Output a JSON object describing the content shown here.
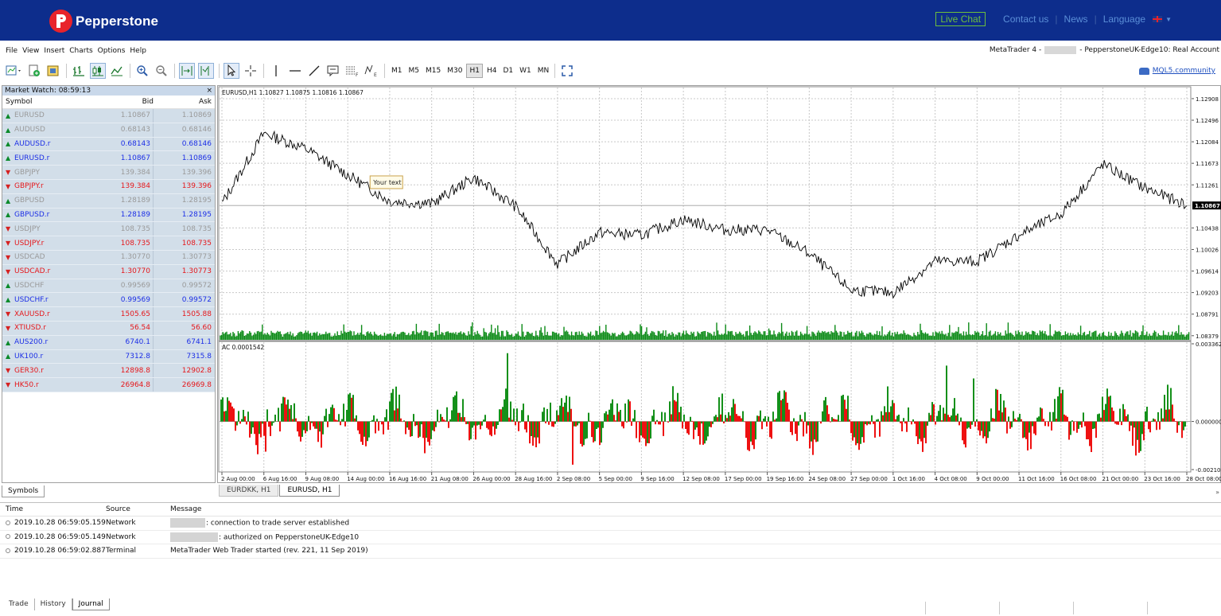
{
  "brand": {
    "name": "Pepperstone"
  },
  "topnav": {
    "live_chat": "Live Chat",
    "contact": "Contact us",
    "news": "News",
    "language": "Language"
  },
  "menu": [
    "File",
    "View",
    "Insert",
    "Charts",
    "Options",
    "Help"
  ],
  "window": {
    "title_prefix": "MetaTrader 4 -",
    "title_suffix": "- PepperstoneUK-Edge10: Real Account"
  },
  "toolbar": {
    "timeframes": [
      "M1",
      "M5",
      "M15",
      "M30",
      "H1",
      "H4",
      "D1",
      "W1",
      "MN"
    ],
    "selected_timeframe": "H1",
    "community_link": "MQL5.community"
  },
  "market_watch": {
    "title": "Market Watch: 08:59:13",
    "close": "×",
    "headers": {
      "symbol": "Symbol",
      "bid": "Bid",
      "ask": "Ask"
    },
    "rows": [
      {
        "symbol": "EURUSD",
        "bid": "1.10867",
        "ask": "1.10869",
        "dir": "up",
        "style": "grey"
      },
      {
        "symbol": "AUDUSD",
        "bid": "0.68143",
        "ask": "0.68146",
        "dir": "up",
        "style": "grey"
      },
      {
        "symbol": "AUDUSD.r",
        "bid": "0.68143",
        "ask": "0.68146",
        "dir": "up",
        "style": "blue"
      },
      {
        "symbol": "EURUSD.r",
        "bid": "1.10867",
        "ask": "1.10869",
        "dir": "up",
        "style": "blue"
      },
      {
        "symbol": "GBPJPY",
        "bid": "139.384",
        "ask": "139.396",
        "dir": "down",
        "style": "grey"
      },
      {
        "symbol": "GBPJPY.r",
        "bid": "139.384",
        "ask": "139.396",
        "dir": "down",
        "style": "red"
      },
      {
        "symbol": "GBPUSD",
        "bid": "1.28189",
        "ask": "1.28195",
        "dir": "up",
        "style": "grey"
      },
      {
        "symbol": "GBPUSD.r",
        "bid": "1.28189",
        "ask": "1.28195",
        "dir": "up",
        "style": "blue"
      },
      {
        "symbol": "USDJPY",
        "bid": "108.735",
        "ask": "108.735",
        "dir": "down",
        "style": "grey"
      },
      {
        "symbol": "USDJPY.r",
        "bid": "108.735",
        "ask": "108.735",
        "dir": "down",
        "style": "red"
      },
      {
        "symbol": "USDCAD",
        "bid": "1.30770",
        "ask": "1.30773",
        "dir": "down",
        "style": "grey"
      },
      {
        "symbol": "USDCAD.r",
        "bid": "1.30770",
        "ask": "1.30773",
        "dir": "down",
        "style": "red"
      },
      {
        "symbol": "USDCHF",
        "bid": "0.99569",
        "ask": "0.99572",
        "dir": "up",
        "style": "grey"
      },
      {
        "symbol": "USDCHF.r",
        "bid": "0.99569",
        "ask": "0.99572",
        "dir": "up",
        "style": "blue"
      },
      {
        "symbol": "XAUUSD.r",
        "bid": "1505.65",
        "ask": "1505.88",
        "dir": "down",
        "style": "red"
      },
      {
        "symbol": "XTIUSD.r",
        "bid": "56.54",
        "ask": "56.60",
        "dir": "down",
        "style": "red"
      },
      {
        "symbol": "AUS200.r",
        "bid": "6740.1",
        "ask": "6741.1",
        "dir": "up",
        "style": "blue"
      },
      {
        "symbol": "UK100.r",
        "bid": "7312.8",
        "ask": "7315.8",
        "dir": "up",
        "style": "blue"
      },
      {
        "symbol": "GER30.r",
        "bid": "12898.8",
        "ask": "12902.8",
        "dir": "down",
        "style": "red"
      },
      {
        "symbol": "HK50.r",
        "bid": "26964.8",
        "ask": "26969.8",
        "dir": "down",
        "style": "red"
      }
    ],
    "tab": "Symbols"
  },
  "chart": {
    "header": "EURUSD,H1  1.10827 1.10875 1.10816 1.10867",
    "annotation": "Your text",
    "current_price": "1.10867",
    "indicator_header": "AC 0.0001542",
    "tabs": [
      "EURDKK, H1",
      "EURUSD, H1"
    ],
    "active_tab": "EURUSD, H1",
    "scroll_marker": "»",
    "colors": {
      "price": "#000000",
      "volume": "#0b8a16",
      "ac_up": "#14901a",
      "ac_down": "#ee1111",
      "grid": "#c8c8c8"
    }
  },
  "chart_data": {
    "type": "line",
    "symbol": "EURUSD",
    "timeframe": "H1",
    "price_ticks": [
      "1.12908",
      "1.12496",
      "1.12084",
      "1.11673",
      "1.11261",
      "1.10438",
      "1.10026",
      "1.09614",
      "1.09203",
      "1.08791",
      "1.08379"
    ],
    "indicator_ticks": [
      "0.0033628",
      "0.0000000",
      "-0.0021079"
    ],
    "x_ticks": [
      "2 Aug 00:00",
      "6 Aug 16:00",
      "9 Aug 08:00",
      "14 Aug 00:00",
      "16 Aug 16:00",
      "21 Aug 08:00",
      "26 Aug 00:00",
      "28 Aug 16:00",
      "2 Sep 08:00",
      "5 Sep 00:00",
      "9 Sep 16:00",
      "12 Sep 08:00",
      "17 Sep 00:00",
      "19 Sep 16:00",
      "24 Sep 08:00",
      "27 Sep 00:00",
      "1 Oct 16:00",
      "4 Oct 08:00",
      "9 Oct 00:00",
      "11 Oct 16:00",
      "16 Oct 08:00",
      "21 Oct 00:00",
      "23 Oct 16:00",
      "28 Oct 08:00"
    ],
    "price_anchors": [
      {
        "x": "2 Aug 00:00",
        "y": 1.109
      },
      {
        "x": "6 Aug 16:00",
        "y": 1.1225
      },
      {
        "x": "9 Aug 08:00",
        "y": 1.1195
      },
      {
        "x": "14 Aug 00:00",
        "y": 1.1145
      },
      {
        "x": "16 Aug 16:00",
        "y": 1.1095
      },
      {
        "x": "21 Aug 08:00",
        "y": 1.109
      },
      {
        "x": "26 Aug 00:00",
        "y": 1.114
      },
      {
        "x": "28 Aug 16:00",
        "y": 1.1085
      },
      {
        "x": "2 Sep 08:00",
        "y": 1.0975
      },
      {
        "x": "5 Sep 00:00",
        "y": 1.1035
      },
      {
        "x": "9 Sep 16:00",
        "y": 1.103
      },
      {
        "x": "12 Sep 08:00",
        "y": 1.106
      },
      {
        "x": "17 Sep 00:00",
        "y": 1.104
      },
      {
        "x": "19 Sep 16:00",
        "y": 1.104
      },
      {
        "x": "24 Sep 08:00",
        "y": 1.0995
      },
      {
        "x": "27 Sep 00:00",
        "y": 1.0925
      },
      {
        "x": "1 Oct 16:00",
        "y": 1.092
      },
      {
        "x": "4 Oct 08:00",
        "y": 1.098
      },
      {
        "x": "9 Oct 00:00",
        "y": 1.098
      },
      {
        "x": "11 Oct 16:00",
        "y": 1.103
      },
      {
        "x": "16 Oct 08:00",
        "y": 1.107
      },
      {
        "x": "21 Oct 00:00",
        "y": 1.1165
      },
      {
        "x": "23 Oct 16:00",
        "y": 1.112
      },
      {
        "x": "28 Oct 08:00",
        "y": 1.1087
      }
    ],
    "last_price": 1.10867,
    "ylim": [
      1.083,
      1.1312
    ],
    "indicator_ylim": [
      -0.0021079,
      0.0033628
    ],
    "grid": true
  },
  "journal": {
    "headers": {
      "time": "Time",
      "source": "Source",
      "message": "Message"
    },
    "rows": [
      {
        "time": "2019.10.28 06:59:05.159",
        "source": "Network",
        "message": ": connection to trade server established",
        "redacted": true
      },
      {
        "time": "2019.10.28 06:59:05.149",
        "source": "Network",
        "message": ": authorized on PepperstoneUK-Edge10",
        "redacted": true
      },
      {
        "time": "2019.10.28 06:59:02.887",
        "source": "Terminal",
        "message": "MetaTrader Web Trader started (rev. 221, 11 Sep 2019)",
        "redacted": false
      }
    ],
    "tabs": [
      "Trade",
      "History",
      "Journal"
    ],
    "active_tab": "Journal"
  }
}
